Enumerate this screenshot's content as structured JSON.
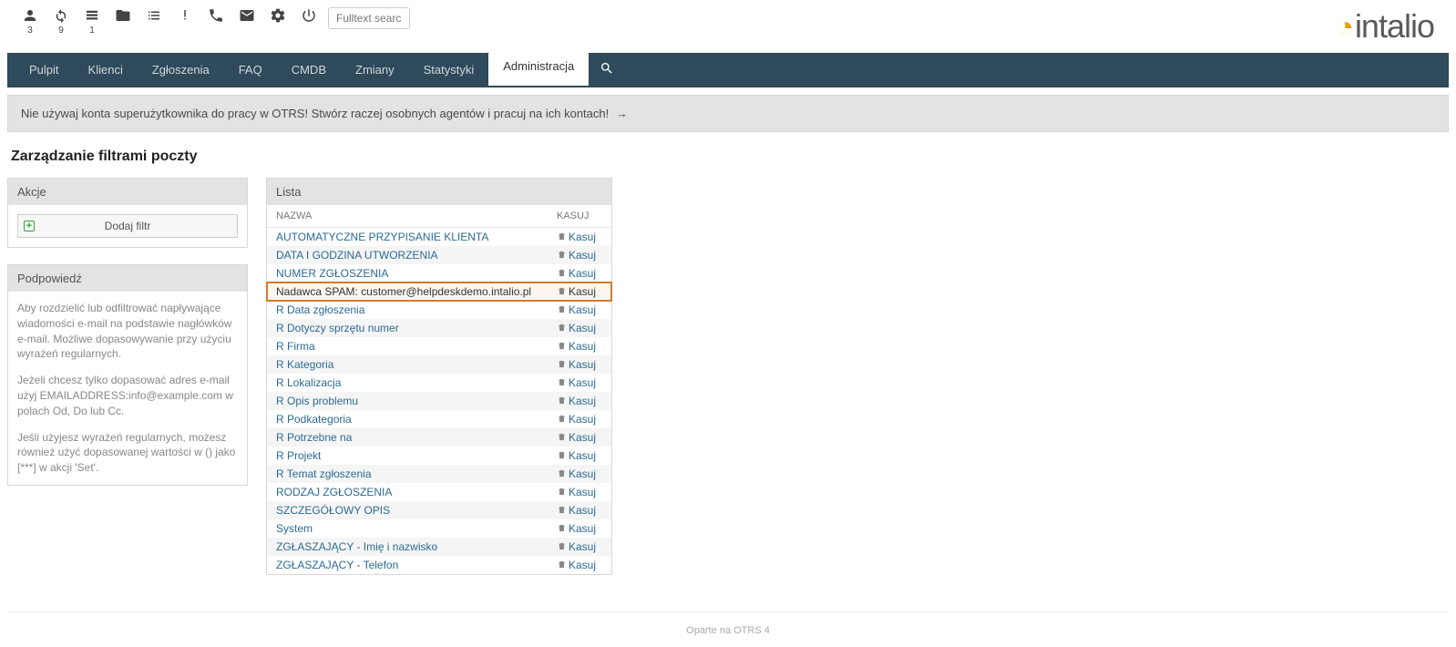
{
  "toolbar": {
    "items": [
      {
        "icon": "person",
        "count": "3"
      },
      {
        "icon": "refresh",
        "count": "9"
      },
      {
        "icon": "stack",
        "count": "1"
      },
      {
        "icon": "folder",
        "count": ""
      },
      {
        "icon": "list",
        "count": ""
      },
      {
        "icon": "exclaim",
        "count": ""
      },
      {
        "icon": "phone",
        "count": ""
      },
      {
        "icon": "mail",
        "count": ""
      },
      {
        "icon": "gear",
        "count": ""
      },
      {
        "icon": "power",
        "count": ""
      }
    ],
    "search_placeholder": "Fulltext search"
  },
  "logo_text": "intalio",
  "nav": {
    "items": [
      {
        "label": "Pulpit",
        "active": false
      },
      {
        "label": "Klienci",
        "active": false
      },
      {
        "label": "Zgłoszenia",
        "active": false
      },
      {
        "label": "FAQ",
        "active": false
      },
      {
        "label": "CMDB",
        "active": false
      },
      {
        "label": "Zmiany",
        "active": false
      },
      {
        "label": "Statystyki",
        "active": false
      },
      {
        "label": "Administracja",
        "active": true
      }
    ]
  },
  "warning": {
    "text": "Nie używaj konta superużytkownika do pracy w OTRS! Stwórz raczej osobnych agentów i pracuj na ich kontach!",
    "arrow": "→"
  },
  "page_title": "Zarządzanie filtrami poczty",
  "actions": {
    "title": "Akcje",
    "add_filter": "Dodaj filtr"
  },
  "hint": {
    "title": "Podpowiedź",
    "p1": "Aby rozdzielić lub odfiltrować napływające wiadomości e-mail na podstawie nagłówków e-mail. Możliwe dopasowywanie przy użyciu wyrażeń regularnych.",
    "p2": "Jeżeli chcesz tylko dopasować adres e-mail użyj EMAILADDRESS:info@example.com w polach Od, Do lub Cc.",
    "p3": "Jeśli użyjesz wyrażeń regularnych, możesz również użyć dopasowanej wartości w () jako [***] w akcji 'Set'."
  },
  "list": {
    "title": "Lista",
    "col_name": "NAZWA",
    "col_del": "KASUJ",
    "del_label": "Kasuj",
    "rows": [
      {
        "name": "AUTOMATYCZNE PRZYPISANIE KLIENTA",
        "hl": false
      },
      {
        "name": "DATA I GODZINA UTWORZENIA",
        "hl": false
      },
      {
        "name": "NUMER ZGŁOSZENIA",
        "hl": false
      },
      {
        "name": "Nadawca SPAM: customer@helpdeskdemo.intalio.pl",
        "hl": true
      },
      {
        "name": "R Data zgłoszenia",
        "hl": false
      },
      {
        "name": "R Dotyczy sprzętu numer",
        "hl": false
      },
      {
        "name": "R Firma",
        "hl": false
      },
      {
        "name": "R Kategoria",
        "hl": false
      },
      {
        "name": "R Lokalizacja",
        "hl": false
      },
      {
        "name": "R Opis problemu",
        "hl": false
      },
      {
        "name": "R Podkategoria",
        "hl": false
      },
      {
        "name": "R Potrzebne na",
        "hl": false
      },
      {
        "name": "R Projekt",
        "hl": false
      },
      {
        "name": "R Temat zgłoszenia",
        "hl": false
      },
      {
        "name": "RODZAJ ZGŁOSZENIA",
        "hl": false
      },
      {
        "name": "SZCZEGÓŁOWY OPIS",
        "hl": false
      },
      {
        "name": "System",
        "hl": false
      },
      {
        "name": "ZGŁASZAJĄCY - Imię i nazwisko",
        "hl": false
      },
      {
        "name": "ZGŁASZAJĄCY - Telefon",
        "hl": false
      }
    ]
  },
  "footer": "Oparte na OTRS 4"
}
